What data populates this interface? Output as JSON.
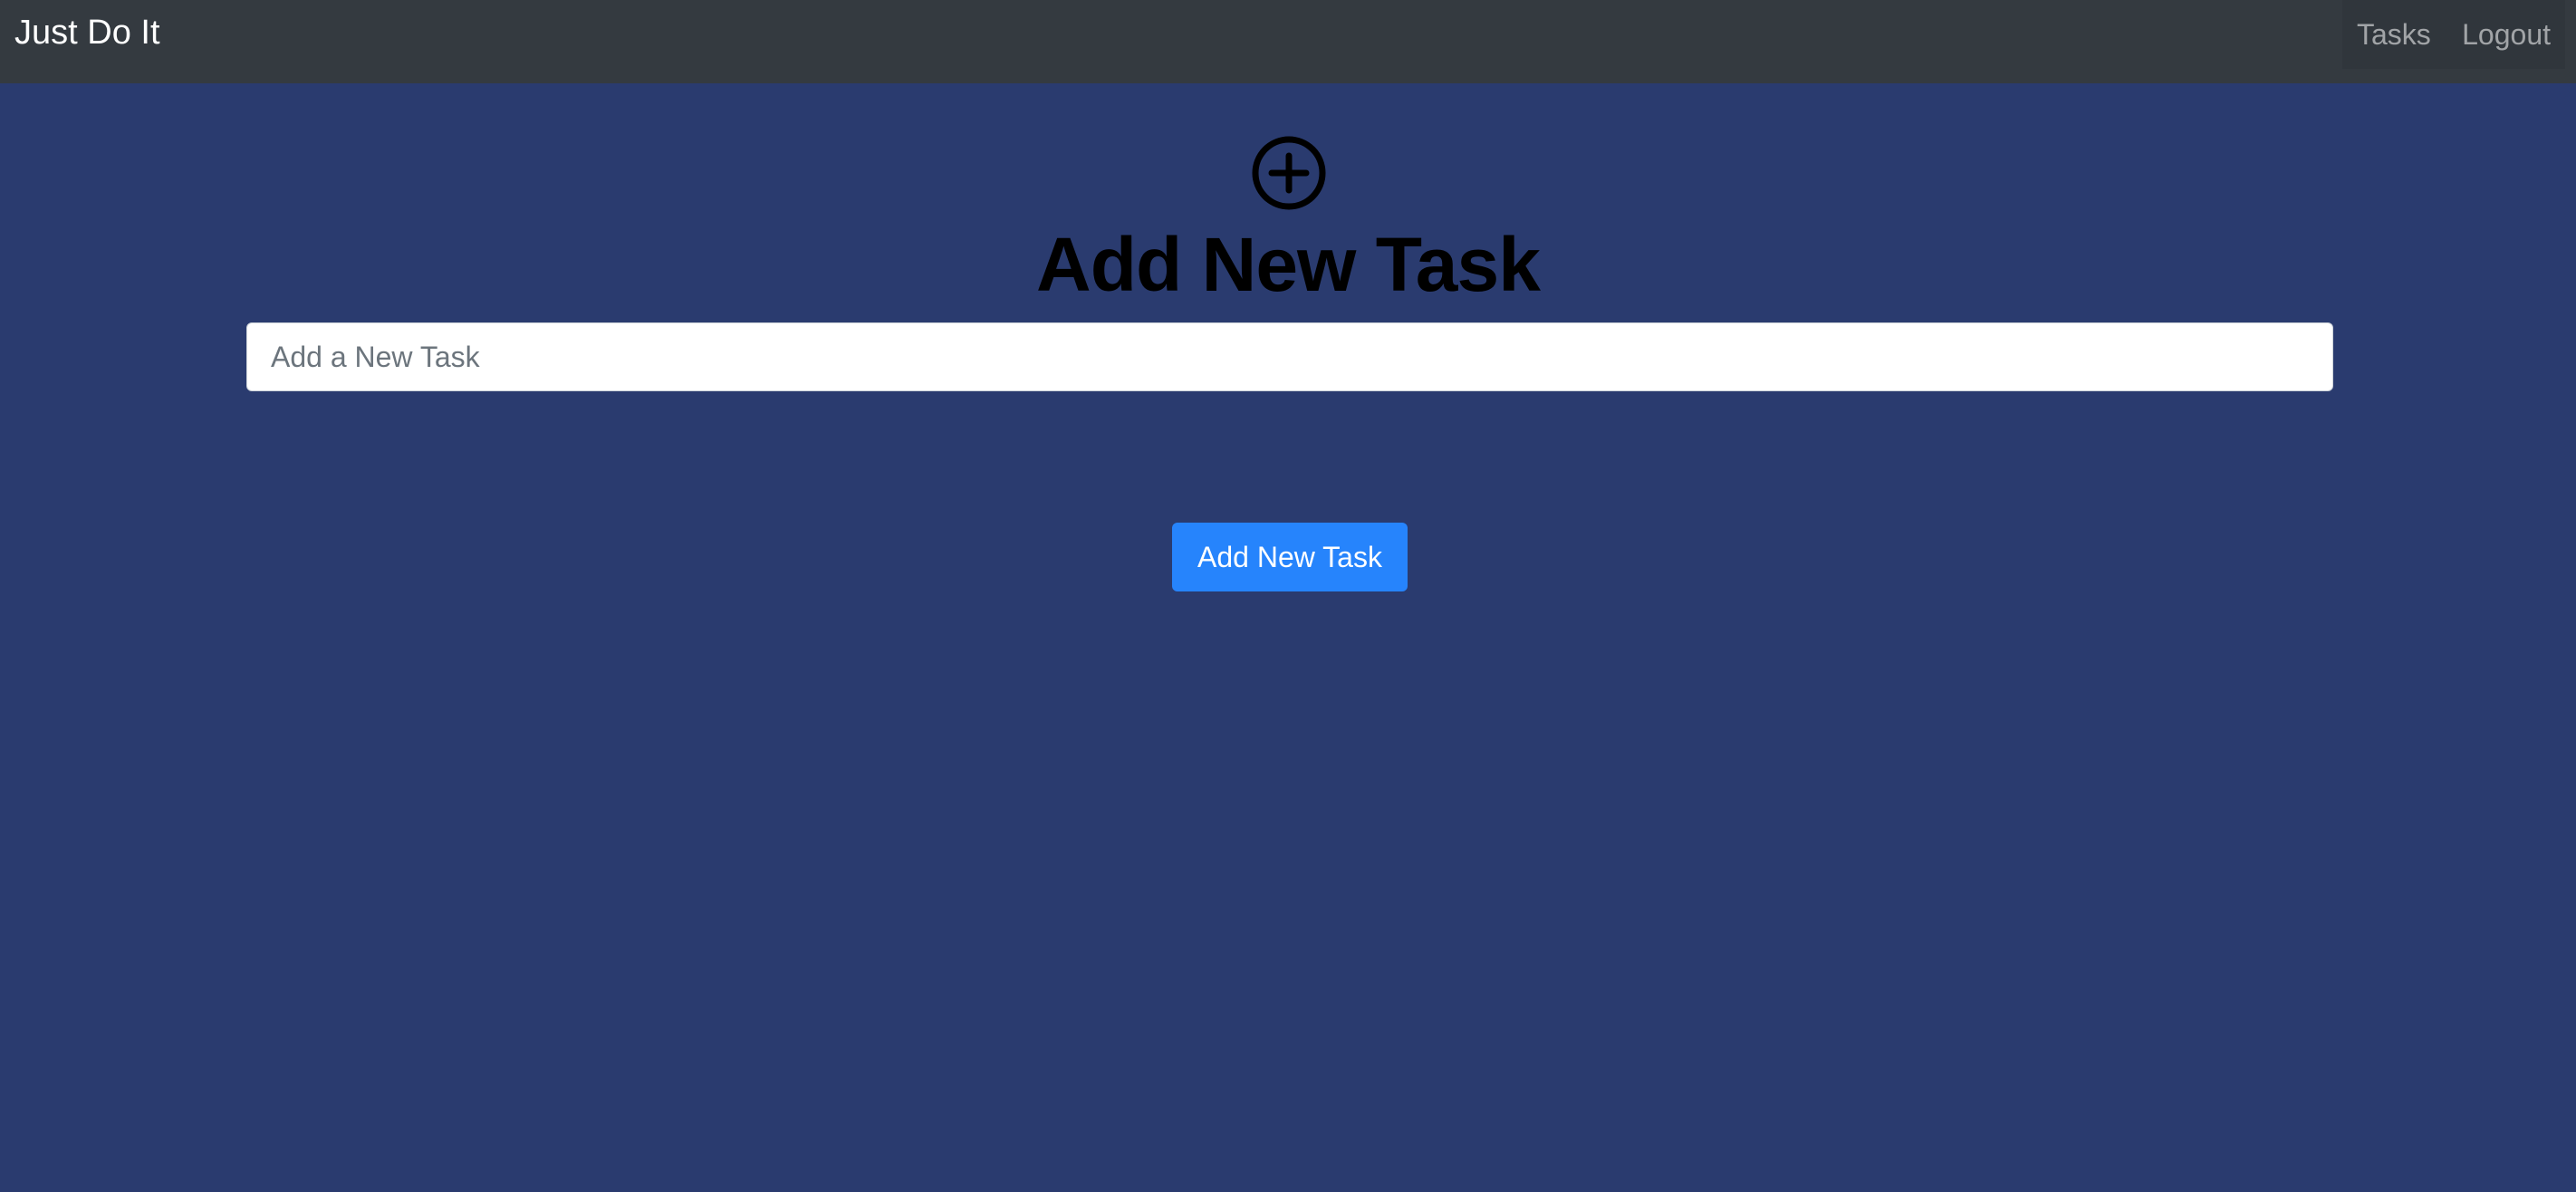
{
  "navbar": {
    "brand": "Just Do It",
    "links": [
      {
        "label": "Tasks"
      },
      {
        "label": "Logout"
      }
    ]
  },
  "main": {
    "icon": "plus-circle-icon",
    "title": "Add New Task",
    "input": {
      "placeholder": "Add a New Task",
      "value": ""
    },
    "submit_label": "Add New Task"
  },
  "colors": {
    "background": "#2a3b6f",
    "navbar": "#343a40",
    "primary_button": "#2684fc"
  }
}
